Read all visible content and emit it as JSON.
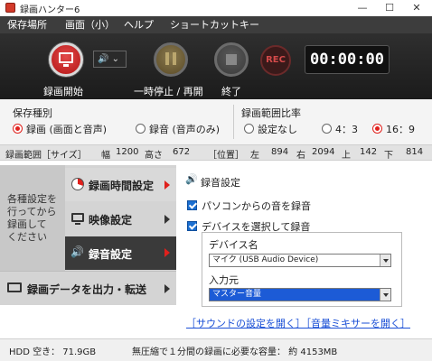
{
  "window": {
    "title": "録画ハンター6",
    "minimize": "—",
    "maximize": "☐",
    "close": "✕"
  },
  "menu": [
    "保存場所",
    "画面（小）",
    "ヘルプ",
    "ショートカットキー"
  ],
  "toolbar": {
    "record_start": "録画開始",
    "pause_resume": "一時停止 / 再開",
    "stop": "終了",
    "rec": "REC",
    "timer": "00:00:00",
    "speaker_dd": "🔊 ⌄"
  },
  "save_type": {
    "title": "保存種別",
    "options": [
      "録画 (画面と音声)",
      "録音 (音声のみ)"
    ],
    "selected": 0
  },
  "range_ratio": {
    "title": "録画範囲比率",
    "options": [
      "設定なし",
      "4：3",
      "16：9"
    ],
    "selected": 2
  },
  "range_bar": {
    "label": "録画範囲［サイズ］",
    "width_label": "幅",
    "width": "1200",
    "height_label": "高さ",
    "height": "672",
    "position_label": "［位置］",
    "left_label": "左",
    "left": "894",
    "right_label": "右",
    "right": "2094",
    "top_label": "上",
    "top": "142",
    "bottom_label": "下",
    "bottom": "814"
  },
  "nav": {
    "description": "各種設定を\n行ってから\n録画して\nください",
    "items": [
      "録画時間設定",
      "映像設定",
      "録音設定"
    ],
    "output": "録画データを出力・転送",
    "active": 2
  },
  "audio": {
    "section_title": "録音設定",
    "pc_sound": "パソコンからの音を録音",
    "device_select": "デバイスを選択して録音",
    "device_name_label": "デバイス名",
    "device_value": "マイク (USB Audio Device)",
    "input_label": "入力元",
    "input_value": "マスター音量",
    "link_sound": "［サウンドの設定を開く］",
    "link_mixer": "［音量ミキサーを開く］"
  },
  "status": {
    "hdd": "HDD 空き： 71.9GB",
    "required": "無圧縮で１分間の録画に必要な容量： 約 4153MB"
  }
}
